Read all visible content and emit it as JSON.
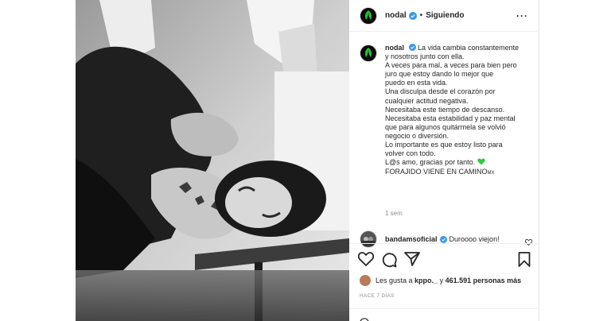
{
  "post": {
    "username": "nodal",
    "follow_status": "Siguiendo",
    "more_icon": "···",
    "caption_lines": [
      "La vida cambia constantemente",
      "y nosotros junto con ella.",
      "A veces para mal, a veces para bien pero",
      "juro que estoy dando lo mejor que",
      "puedo en esta vida.",
      "Una disculpa desde el corazón por",
      "cualquier actitud negativa.",
      "Necesitaba este tiempo de descanso.",
      "Necesitaba esta estabilidad y paz mental",
      "que para algunos quitármela se volvió",
      "negocio o diversión.",
      "Lo importante es que estoy listo para",
      "volver con todo.",
      "L@s amo, gracias por tanto.",
      "FORAJIDO VIENE EN CAMINO"
    ],
    "caption_suffix": "MX",
    "caption_time": "1 sem",
    "comment": {
      "username": "bandamsoficial",
      "text": "Duroooo viejon!"
    },
    "likes_text_prefix": "Les gusta a ",
    "likes_user": "kppo._",
    "likes_middle": " y ",
    "likes_count": "461.591 personas más",
    "posted_ago": "HACE 7 DÍAS"
  },
  "icons": [
    "verified-badge-icon",
    "heart-icon",
    "comment-icon",
    "share-icon",
    "bookmark-icon",
    "green-heart-icon"
  ],
  "colors": {
    "verified": "#3897f0",
    "green_heart": "#2ecc40",
    "muted": "#8e8e8e"
  }
}
